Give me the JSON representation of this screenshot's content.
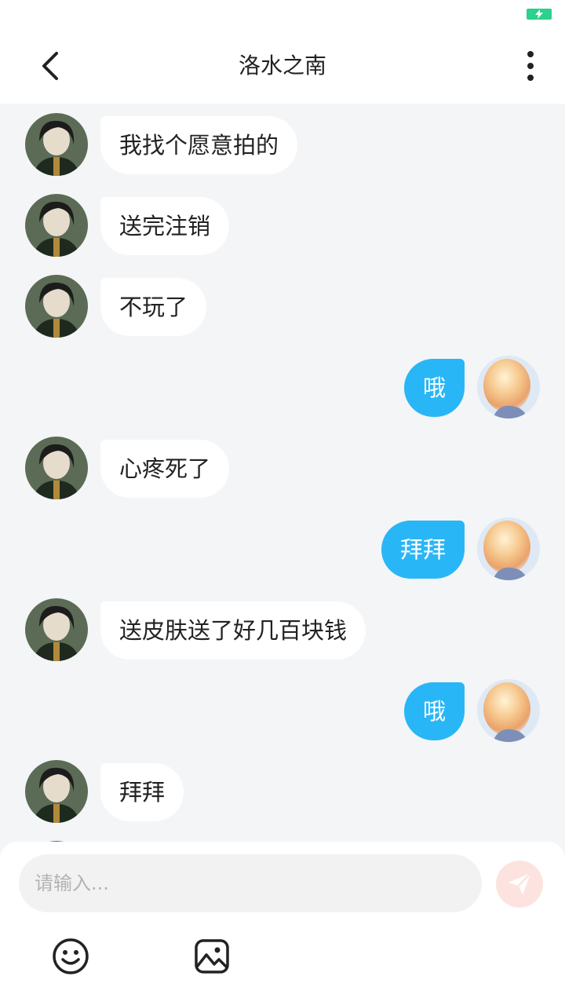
{
  "header": {
    "title": "洛水之南"
  },
  "messages": [
    {
      "side": "in",
      "text": "我找个愿意拍的"
    },
    {
      "side": "in",
      "text": "送完注销"
    },
    {
      "side": "in",
      "text": "不玩了"
    },
    {
      "side": "out",
      "text": "哦"
    },
    {
      "side": "in",
      "text": "心疼死了"
    },
    {
      "side": "out",
      "text": "拜拜"
    },
    {
      "side": "in",
      "text": "送皮肤送了好几百块钱"
    },
    {
      "side": "out",
      "text": "哦"
    },
    {
      "side": "in",
      "text": "拜拜"
    }
  ],
  "composer": {
    "placeholder": "请输入..."
  },
  "colors": {
    "accent": "#29b6f6",
    "chat_background": "#f3f5f7",
    "incoming_bubble": "#ffffff",
    "send_button": "#fde3df",
    "battery": "#2bd18c"
  },
  "icons": {
    "back": "back-arrow-icon",
    "more": "more-vertical-icon",
    "send": "paper-plane-icon",
    "emoji": "smiley-icon",
    "image": "image-icon",
    "battery": "battery-charging-icon"
  }
}
